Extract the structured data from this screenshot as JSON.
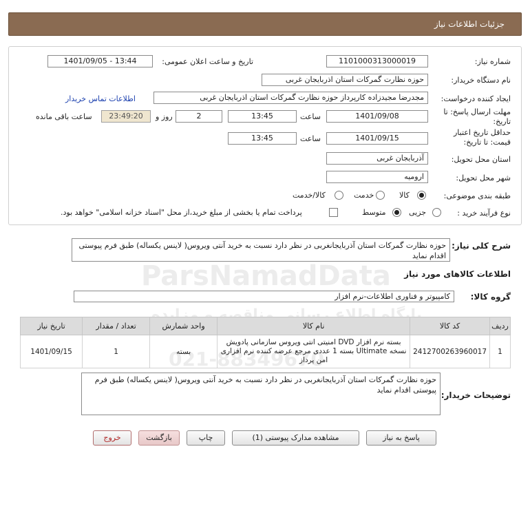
{
  "header": {
    "title": "جزئیات اطلاعات نیاز"
  },
  "fields": {
    "need_number_label": "شماره نیاز:",
    "need_number": "1101000313000019",
    "announce_label": "تاریخ و ساعت اعلان عمومی:",
    "announce_value": "1401/09/05 - 13:44",
    "buyer_org_label": "نام دستگاه خریدار:",
    "buyer_org": "حوزه نظارت گمرکات استان اذربایجان غربی",
    "creator_label": "ایجاد کننده درخواست:",
    "creator": "مجدرضا مجیدزاده کارپرداز حوزه نظارت گمرکات استان اذربایجان غربی",
    "contact_link": "اطلاعات تماس خریدار",
    "deadline_label_1": "مهلت ارسال پاسخ: تا",
    "deadline_label_2": "تاریخ:",
    "deadline_date": "1401/09/08",
    "time_label": "ساعت",
    "deadline_time": "13:45",
    "days_label": "روز و",
    "days_value": "2",
    "countdown": "23:49:20",
    "remaining_label": "ساعت باقی مانده",
    "validity_label_1": "حداقل تاریخ اعتبار",
    "validity_label_2": "قیمت: تا تاریخ:",
    "validity_date": "1401/09/15",
    "validity_time": "13:45",
    "province_label": "استان محل تحویل:",
    "province": "آذربایجان غربی",
    "city_label": "شهر محل تحویل:",
    "city": "ارومیه",
    "category_label": "طبقه بندی موضوعی:",
    "category_options": [
      "کالا",
      "خدمت",
      "کالا/خدمت"
    ],
    "process_label": "نوع فرآیند خرید :",
    "process_options": [
      "جزیی",
      "متوسط"
    ],
    "payment_note": "پرداخت تمام یا بخشی از مبلغ خرید،از محل \"اسناد خزانه اسلامی\" خواهد بود."
  },
  "summary": {
    "label": "شرح کلی نیاز:",
    "text": "حوزه نظارت گمرکات استان آذربایجانغربی در نظر دارد نسبت به خرید آنتی ویروس( لاینس یکساله) طبق فرم پیوستی اقدام نماید"
  },
  "goods": {
    "section_title": "اطلاعات کالاهای مورد نیاز",
    "group_label": "گروه کالا:",
    "group_value": "کامپیوتر و فناوری اطلاعات-نرم افزار",
    "columns": [
      "ردیف",
      "کد کالا",
      "نام کالا",
      "واحد شمارش",
      "تعداد / مقدار",
      "تاریخ نیاز"
    ],
    "rows": [
      {
        "row": "1",
        "code": "2412700263960017",
        "name": "بسته نرم افزار DVD امنیتی انتی ویروس سازمانی پادویش نسخه Ultimate بسته 1 عددی مرجع عرضه کننده نرم افزاری امن پرداز",
        "unit": "بسته",
        "qty": "1",
        "date": "1401/09/15"
      }
    ]
  },
  "buyer_notes": {
    "label": "توضیحات خریدار:",
    "text": "حوزه نظارت گمرکات استان آذربایجانغربی در نظر دارد نسبت به خرید آنتی ویروس( لاینس یکساله) طبق فرم پیوستی اقدام نماید"
  },
  "buttons": {
    "reply": "پاسخ به نیاز",
    "attachments": "مشاهده مدارک پیوستی (1)",
    "print": "چاپ",
    "back": "بازگشت",
    "exit": "خروج"
  },
  "watermark": {
    "brand": "ParsNamadData",
    "line1": "پایگاه اطلاع رسانی مناقصه و مزایده",
    "line2": "021-88349670"
  },
  "colors": {
    "header_bg": "#8a6b52",
    "timer_bg": "#efe6cf",
    "link": "#1a3fae",
    "exit": "#b02525"
  }
}
